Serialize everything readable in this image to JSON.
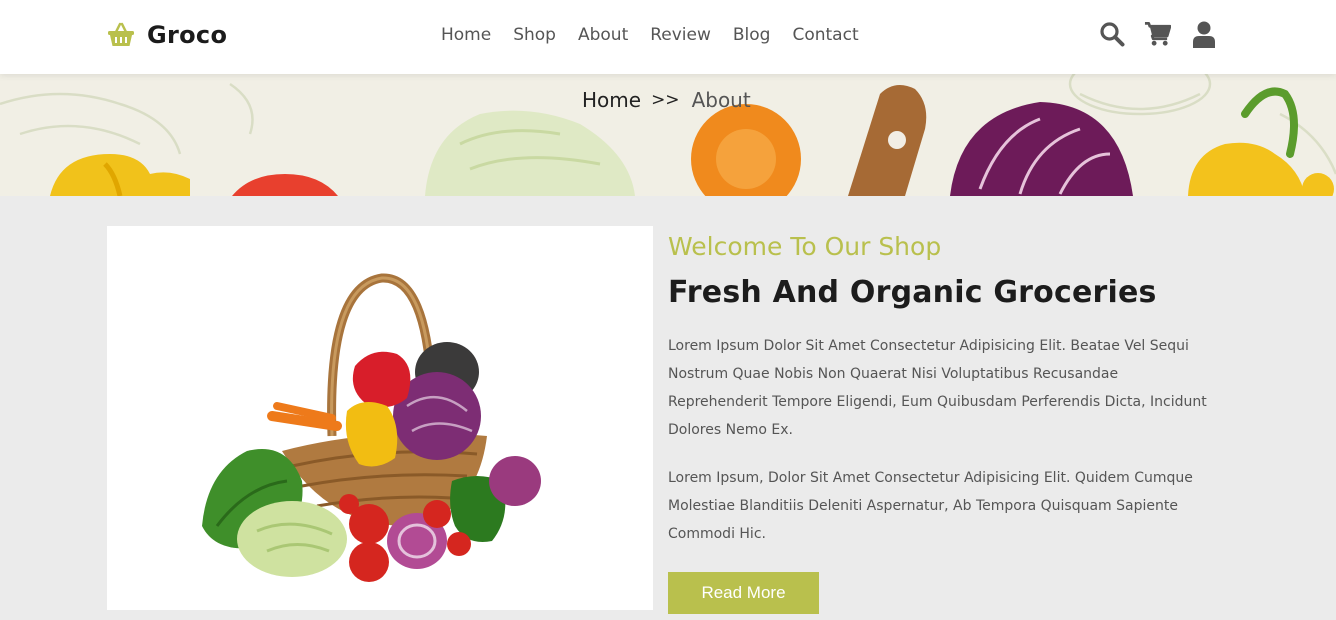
{
  "brand": {
    "name": "Groco",
    "accent": "#b9c04d"
  },
  "nav": {
    "items": [
      {
        "label": "Home"
      },
      {
        "label": "Shop"
      },
      {
        "label": "About"
      },
      {
        "label": "Review"
      },
      {
        "label": "Blog"
      },
      {
        "label": "Contact"
      }
    ]
  },
  "header_icons": [
    "search-icon",
    "cart-icon",
    "user-icon"
  ],
  "breadcrumb": {
    "home": "Home",
    "separator": ">>",
    "current": "About"
  },
  "about": {
    "welcome": "Welcome To Our Shop",
    "title": "Fresh And Organic Groceries",
    "paragraph1": "Lorem Ipsum Dolor Sit Amet Consectetur Adipisicing Elit. Beatae Vel Sequi Nostrum Quae Nobis Non Quaerat Nisi Voluptatibus Recusandae Reprehenderit Tempore Eligendi, Eum Quibusdam Perferendis Dicta, Incidunt Dolores Nemo Ex.",
    "paragraph2": "Lorem Ipsum, Dolor Sit Amet Consectetur Adipisicing Elit. Quidem Cumque Molestiae Blanditiis Deleniti Aspernatur, Ab Tempora Quisquam Sapiente Commodi Hic.",
    "button": "Read More"
  }
}
